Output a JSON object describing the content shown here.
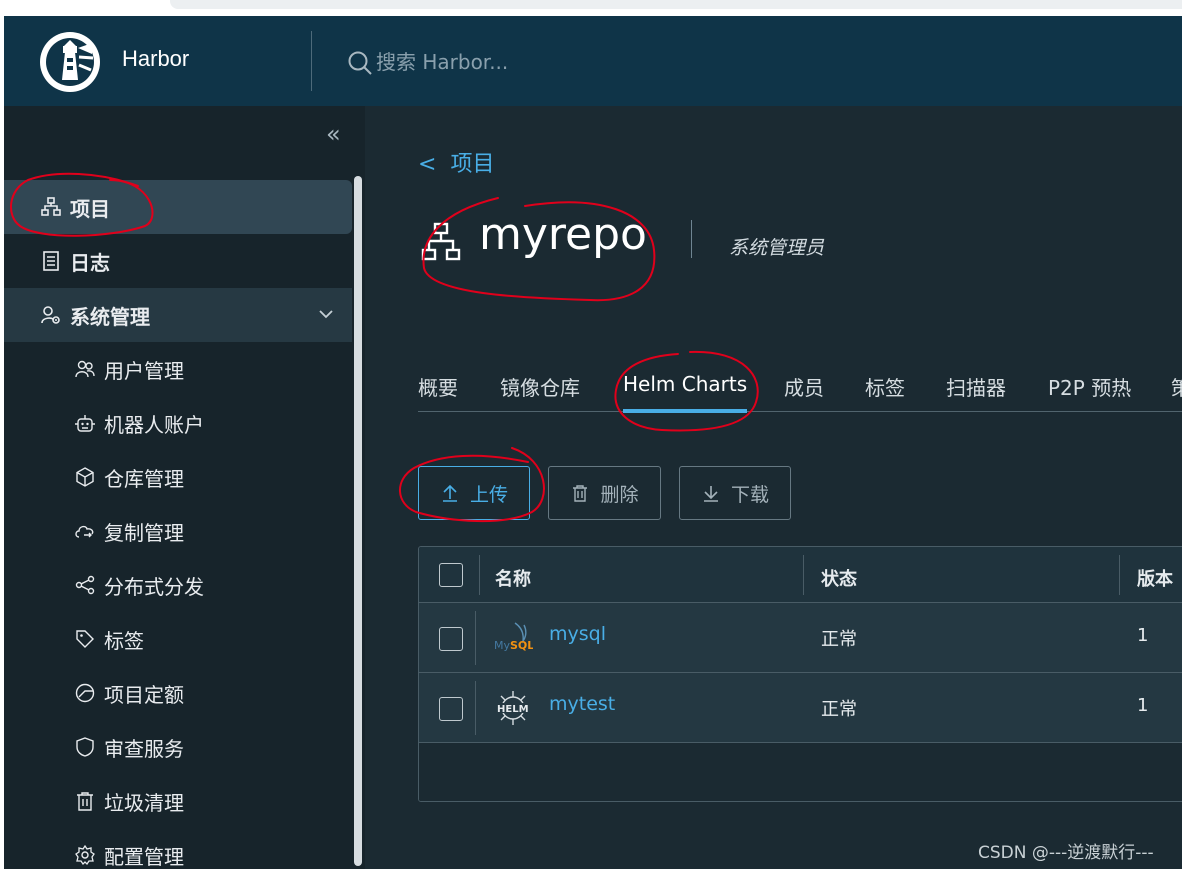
{
  "header": {
    "brand": "Harbor",
    "search_placeholder": "搜索 Harbor..."
  },
  "sidebar": {
    "collapse_label": "«",
    "items": [
      {
        "label": "项目",
        "icon": "project-icon"
      },
      {
        "label": "日志",
        "icon": "log-icon"
      },
      {
        "label": "系统管理",
        "icon": "admin-icon"
      }
    ],
    "sub_items": [
      {
        "label": "用户管理",
        "icon": "users-icon"
      },
      {
        "label": "机器人账户",
        "icon": "robot-icon"
      },
      {
        "label": "仓库管理",
        "icon": "registry-icon"
      },
      {
        "label": "复制管理",
        "icon": "replication-icon"
      },
      {
        "label": "分布式分发",
        "icon": "share-icon"
      },
      {
        "label": "标签",
        "icon": "tag-icon"
      },
      {
        "label": "项目定额",
        "icon": "quota-icon"
      },
      {
        "label": "审查服务",
        "icon": "shield-icon"
      },
      {
        "label": "垃圾清理",
        "icon": "trash-icon"
      },
      {
        "label": "配置管理",
        "icon": "gear-icon"
      }
    ]
  },
  "main": {
    "back_label": "项目",
    "project_name": "myrepo",
    "role": "系统管理员",
    "tabs": [
      "概要",
      "镜像仓库",
      "Helm Charts",
      "成员",
      "标签",
      "扫描器",
      "P2P 预热",
      "策"
    ],
    "active_tab": "Helm Charts",
    "buttons": {
      "upload": "上传",
      "delete": "删除",
      "download": "下载"
    },
    "table": {
      "columns": [
        "名称",
        "状态",
        "版本"
      ],
      "rows": [
        {
          "name": "mysql",
          "status": "正常",
          "version": "1",
          "icon": "mysql-logo"
        },
        {
          "name": "mytest",
          "status": "正常",
          "version": "1",
          "icon": "helm-logo"
        }
      ]
    }
  },
  "watermark": "CSDN @---逆渡默行---",
  "colors": {
    "header_bg": "#0f3448",
    "sidebar_bg": "#17242b",
    "main_bg": "#1b2a32",
    "accent": "#49aee6",
    "annotation": "#e0001b"
  }
}
